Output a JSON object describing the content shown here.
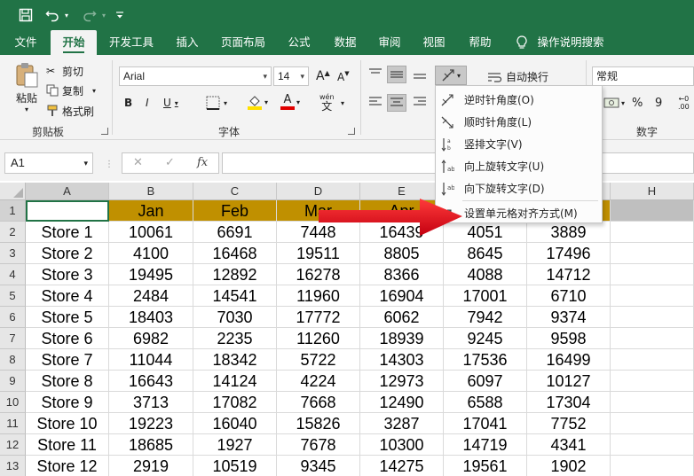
{
  "qat": {
    "save_icon": "save-icon",
    "undo_icon": "undo-icon",
    "redo_icon": "redo-icon",
    "customize_icon": "customize-qat-icon"
  },
  "tabs": [
    "文件",
    "开始",
    "开发工具",
    "插入",
    "页面布局",
    "公式",
    "数据",
    "审阅",
    "视图",
    "帮助",
    "操作说明搜索"
  ],
  "active_tab": "开始",
  "ribbon": {
    "clipboard": {
      "paste": "粘贴",
      "cut": "剪切",
      "copy": "复制",
      "format_painter": "格式刷",
      "group_label": "剪贴板"
    },
    "font": {
      "font_name": "Arial",
      "font_size": "14",
      "bold": "B",
      "italic": "I",
      "underline": "U",
      "grow": "A",
      "shrink": "A",
      "font_color_letter": "A",
      "wen": "wén",
      "wen_char": "文",
      "group_label": "字体"
    },
    "alignment": {
      "wrap_text": "自动换行"
    },
    "number": {
      "format": "常规",
      "percent": "%",
      "comma": "9",
      "group_label": "数字"
    },
    "colors": {
      "accent": "#217346",
      "fill_yellow": "#ffe000",
      "font_red": "#e00000"
    }
  },
  "formula_bar": {
    "name_box": "A1",
    "cancel": "✕",
    "enter": "✓",
    "fx": "fx",
    "formula": ""
  },
  "grid": {
    "columns": [
      "A",
      "B",
      "C",
      "D",
      "E",
      "F",
      "G",
      "H"
    ],
    "header_row": [
      "",
      "Jan",
      "Feb",
      "Mar",
      "Apr",
      "",
      "",
      ""
    ],
    "rows": [
      {
        "num": "2",
        "cells": [
          "Store 1",
          "10061",
          "6691",
          "7448",
          "16439",
          "4051",
          "3889"
        ]
      },
      {
        "num": "3",
        "cells": [
          "Store 2",
          "4100",
          "16468",
          "19511",
          "8805",
          "8645",
          "17496"
        ]
      },
      {
        "num": "4",
        "cells": [
          "Store 3",
          "19495",
          "12892",
          "16278",
          "8366",
          "4088",
          "14712"
        ]
      },
      {
        "num": "5",
        "cells": [
          "Store 4",
          "2484",
          "14541",
          "11960",
          "16904",
          "17001",
          "6710"
        ]
      },
      {
        "num": "6",
        "cells": [
          "Store 5",
          "18403",
          "7030",
          "17772",
          "6062",
          "7942",
          "9374"
        ]
      },
      {
        "num": "7",
        "cells": [
          "Store 6",
          "6982",
          "2235",
          "11260",
          "18939",
          "9245",
          "9598"
        ]
      },
      {
        "num": "8",
        "cells": [
          "Store 7",
          "11044",
          "18342",
          "5722",
          "14303",
          "17536",
          "16499"
        ]
      },
      {
        "num": "9",
        "cells": [
          "Store 8",
          "16643",
          "14124",
          "4224",
          "12973",
          "6097",
          "10127"
        ]
      },
      {
        "num": "10",
        "cells": [
          "Store 9",
          "3713",
          "17082",
          "7668",
          "12490",
          "6588",
          "17304"
        ]
      },
      {
        "num": "11",
        "cells": [
          "Store 10",
          "19223",
          "16040",
          "15826",
          "3287",
          "17041",
          "7752"
        ]
      },
      {
        "num": "12",
        "cells": [
          "Store 11",
          "18685",
          "1927",
          "7678",
          "10300",
          "14719",
          "4341"
        ]
      },
      {
        "num": "13",
        "cells": [
          "Store 12",
          "2919",
          "10519",
          "9345",
          "14275",
          "19561",
          "1902"
        ]
      }
    ],
    "header_fill": "#c09000"
  },
  "orientation_menu": {
    "items": [
      {
        "label": "逆时针角度(O)",
        "icon": "rotate-ccw-icon"
      },
      {
        "label": "顺时针角度(L)",
        "icon": "rotate-cw-icon"
      },
      {
        "label": "竖排文字(V)",
        "icon": "vertical-text-icon"
      },
      {
        "label": "向上旋转文字(U)",
        "icon": "rotate-up-icon"
      },
      {
        "label": "向下旋转文字(D)",
        "icon": "rotate-down-icon"
      },
      {
        "label": "设置单元格对齐方式(M)",
        "icon": "format-alignment-icon"
      }
    ]
  },
  "annotation": {
    "arrow_color": "#e8131b"
  }
}
